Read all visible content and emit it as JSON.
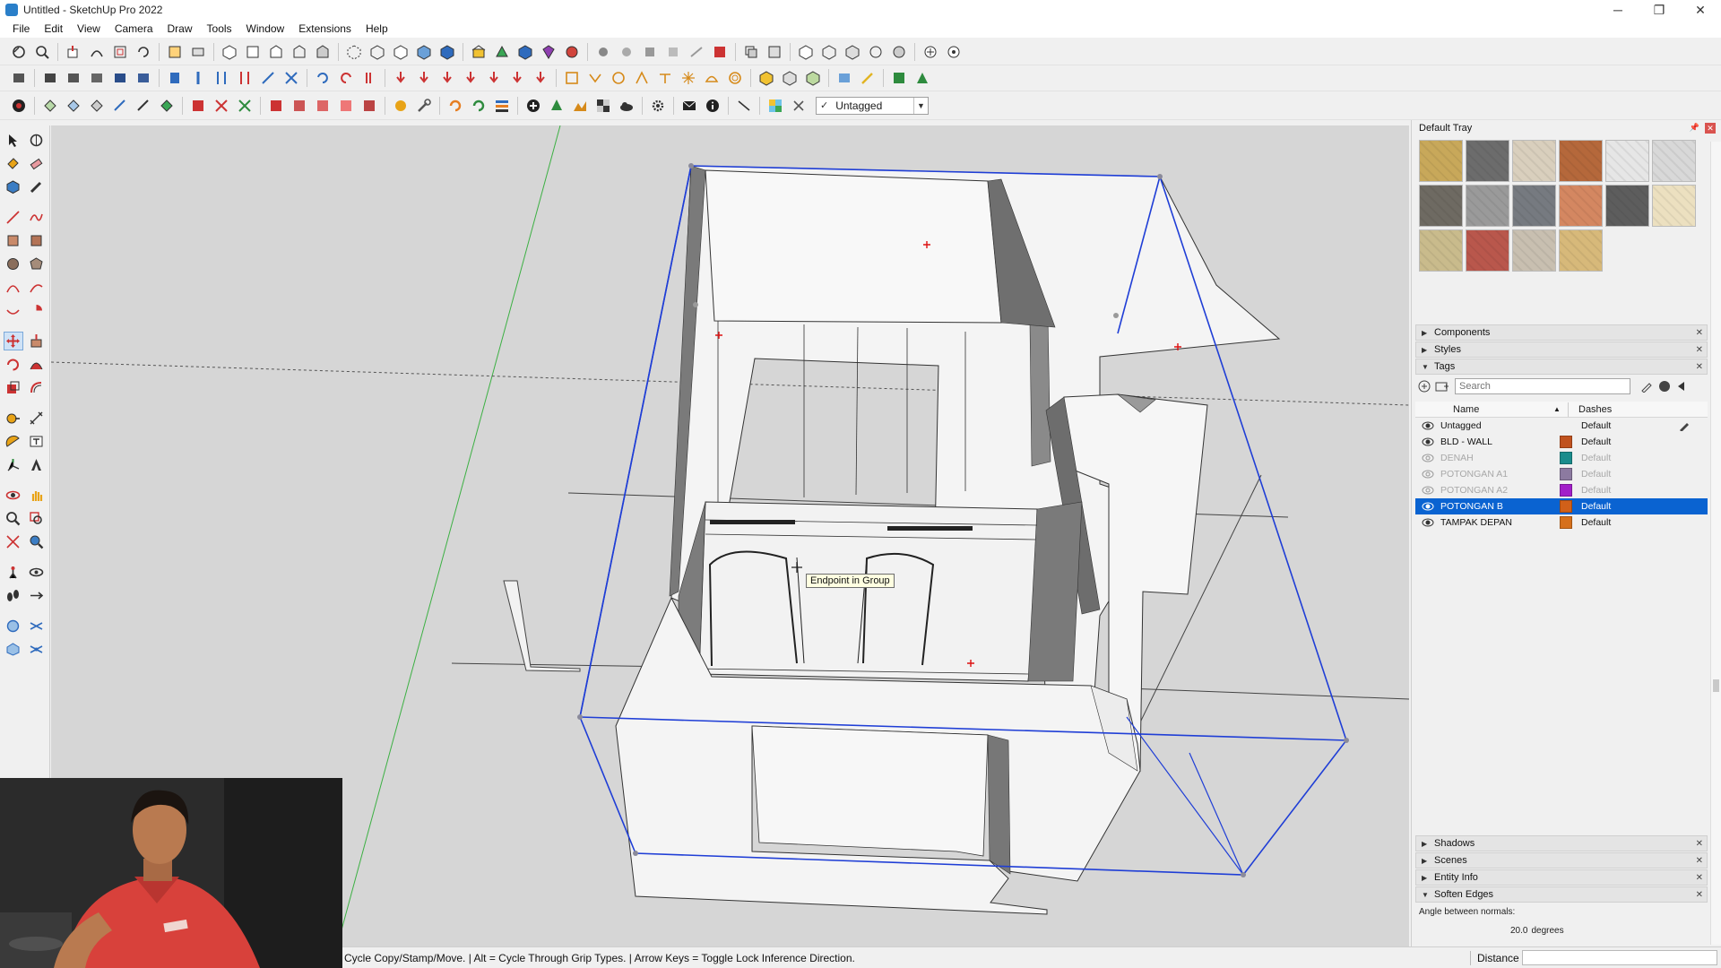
{
  "app": {
    "window_title": "Untitled - SketchUp Pro 2022",
    "controls": {
      "minimize": "─",
      "restore": "❐",
      "close": "✕"
    }
  },
  "menu": [
    "File",
    "Edit",
    "View",
    "Camera",
    "Draw",
    "Tools",
    "Window",
    "Extensions",
    "Help"
  ],
  "toolbar": {
    "tag_dropdown": {
      "check": "✓",
      "value": "Untagged"
    }
  },
  "viewport": {
    "tooltip": "Endpoint in Group"
  },
  "statusbar": {
    "hint": "Cycle Copy/Stamp/Move. | Alt = Cycle Through Grip Types. | Arrow Keys = Toggle Lock Inference Direction.",
    "measurement_label": "Distance"
  },
  "tray": {
    "title": "Default Tray",
    "materials": [
      "#c8a85a",
      "#6c6c6c",
      "#d9cfbd",
      "#b5683b",
      "#e6e6e6",
      "#d8d8d8",
      "#6e6a62",
      "#9a9a9a",
      "#767a80",
      "#d48761",
      "#5d5d5d",
      "#ece0c0",
      "#c9bb8c",
      "#b9574c",
      "#c8bfb0",
      "#d7b97a"
    ],
    "panels_top": [
      "Components",
      "Styles"
    ],
    "tags_panel": {
      "title": "Tags",
      "search_placeholder": "Search",
      "columns": {
        "name": "Name",
        "dashes": "Dashes"
      },
      "rows": [
        {
          "name": "Untagged",
          "visible": true,
          "color": "",
          "dashes": "Default",
          "active": true
        },
        {
          "name": "BLD - WALL",
          "visible": true,
          "color": "#c0521e",
          "dashes": "Default"
        },
        {
          "name": "DENAH",
          "visible": false,
          "color": "#1a8c8c",
          "dashes": "Default"
        },
        {
          "name": "POTONGAN A1",
          "visible": false,
          "color": "#8c7aa0",
          "dashes": "Default"
        },
        {
          "name": "POTONGAN A2",
          "visible": false,
          "color": "#a21fc9",
          "dashes": "Default"
        },
        {
          "name": "POTONGAN B",
          "visible": true,
          "color": "#d16019",
          "dashes": "Default",
          "selected": true
        },
        {
          "name": "TAMPAK DEPAN",
          "visible": true,
          "color": "#d6701c",
          "dashes": "Default"
        }
      ]
    },
    "panels_bottom": [
      "Shadows",
      "Scenes",
      "Entity Info"
    ],
    "soften_edges": {
      "title": "Soften Edges",
      "label": "Angle between normals:",
      "value": "20.0",
      "unit": "degrees"
    }
  }
}
